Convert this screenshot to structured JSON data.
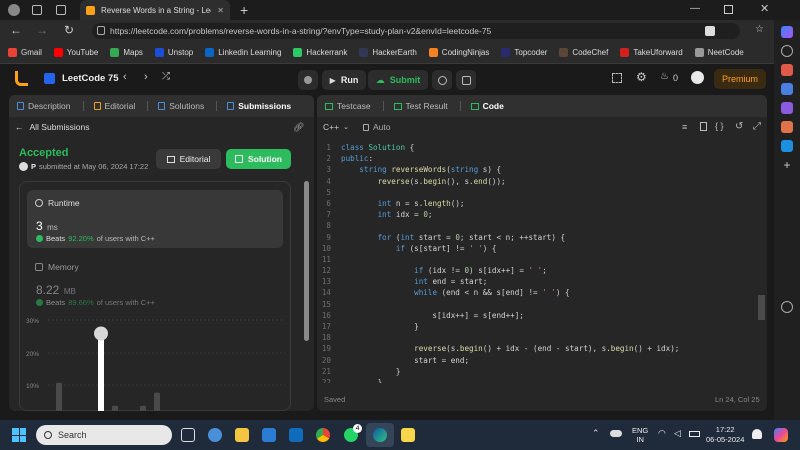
{
  "browser": {
    "tab_title": "Reverse Words in a String - Leet",
    "url": "https://leetcode.com/problems/reverse-words-in-a-string/?envType=study-plan-v2&envId=leetcode-75",
    "bookmarks": [
      {
        "label": "Gmail",
        "color": "#ea4335"
      },
      {
        "label": "YouTube",
        "color": "#ff0000"
      },
      {
        "label": "Maps",
        "color": "#34a853"
      },
      {
        "label": "Unstop",
        "color": "#1c4ed8"
      },
      {
        "label": "Linkedin Learning",
        "color": "#0a66c2"
      },
      {
        "label": "Hackerrank",
        "color": "#2ec866"
      },
      {
        "label": "HackerEarth",
        "color": "#323754"
      },
      {
        "label": "CodingNinjas",
        "color": "#f58220"
      },
      {
        "label": "Topcoder",
        "color": "#2a2a6e"
      },
      {
        "label": "CodeChef",
        "color": "#5b4638"
      },
      {
        "label": "TakeUforward",
        "color": "#d41f1f"
      },
      {
        "label": "NeetCode",
        "color": "#999999"
      }
    ]
  },
  "header": {
    "title": "LeetCode 75",
    "run_label": "Run",
    "submit_label": "Submit",
    "streak_count": "0",
    "premium_label": "Premium"
  },
  "left": {
    "tabs": [
      {
        "label": "Description",
        "icon": "description-icon"
      },
      {
        "label": "Editorial",
        "icon": "editorial-icon"
      },
      {
        "label": "Solutions",
        "icon": "solutions-icon"
      },
      {
        "label": "Submissions",
        "icon": "submissions-icon"
      }
    ],
    "back_label": "All Submissions",
    "status": "Accepted",
    "user_initial": "P",
    "submitted_text": "submitted at May 06, 2024 17:22",
    "editorial_button": "Editorial",
    "solution_button": "Solution",
    "runtime": {
      "label": "Runtime",
      "value": "3",
      "unit": "ms",
      "beats_label": "Beats",
      "beats_value": "92.20%",
      "beats_suffix": "of users with C++"
    },
    "memory": {
      "label": "Memory",
      "value": "8.22",
      "unit": "MB",
      "beats_label": "Beats",
      "beats_value": "89.66%",
      "beats_suffix": "of users with C++"
    },
    "chart_data": {
      "type": "bar",
      "yticks": [
        "30%",
        "20%",
        "10%"
      ],
      "ylim": [
        0,
        30
      ],
      "values": [
        11,
        0,
        0,
        25,
        4,
        0,
        4,
        8,
        1
      ],
      "highlight_index": 3
    }
  },
  "right": {
    "tabs": [
      {
        "label": "Testcase",
        "icon": "testcase-icon"
      },
      {
        "label": "Test Result",
        "icon": "terminal-icon"
      },
      {
        "label": "Code",
        "icon": "code-icon"
      }
    ],
    "language": "C++",
    "mode": "Auto",
    "code_lines": [
      "class Solution {",
      "public:",
      "    string reverseWords(string s) {",
      "        reverse(s.begin(), s.end());",
      "",
      "        int n = s.length();",
      "        int idx = 0;",
      "",
      "        for (int start = 0; start < n; ++start) {",
      "            if (s[start] != ' ') {",
      "",
      "                if (idx != 0) s[idx++] = ' ';",
      "                int end = start;",
      "                while (end < n && s[end] != ' ') {",
      "",
      "                    s[idx++] = s[end++];",
      "                }",
      "",
      "                reverse(s.begin() + idx - (end - start), s.begin() + idx);",
      "                start = end;",
      "            }",
      "        }"
    ],
    "line_numbers": [
      "1",
      "2",
      "3",
      "4",
      "5",
      "6",
      "7",
      "8",
      "9",
      "10",
      "11",
      "12",
      "13",
      "14",
      "15",
      "16",
      "17",
      "18",
      "19",
      "20",
      "21",
      "22"
    ],
    "saved_label": "Saved",
    "cursor_position": "Ln 24, Col 25"
  },
  "taskbar": {
    "search_placeholder": "Search",
    "lang_top": "ENG",
    "lang_bottom": "IN",
    "time": "17:22",
    "date": "06-05-2024",
    "whatsapp_badge": "4"
  }
}
